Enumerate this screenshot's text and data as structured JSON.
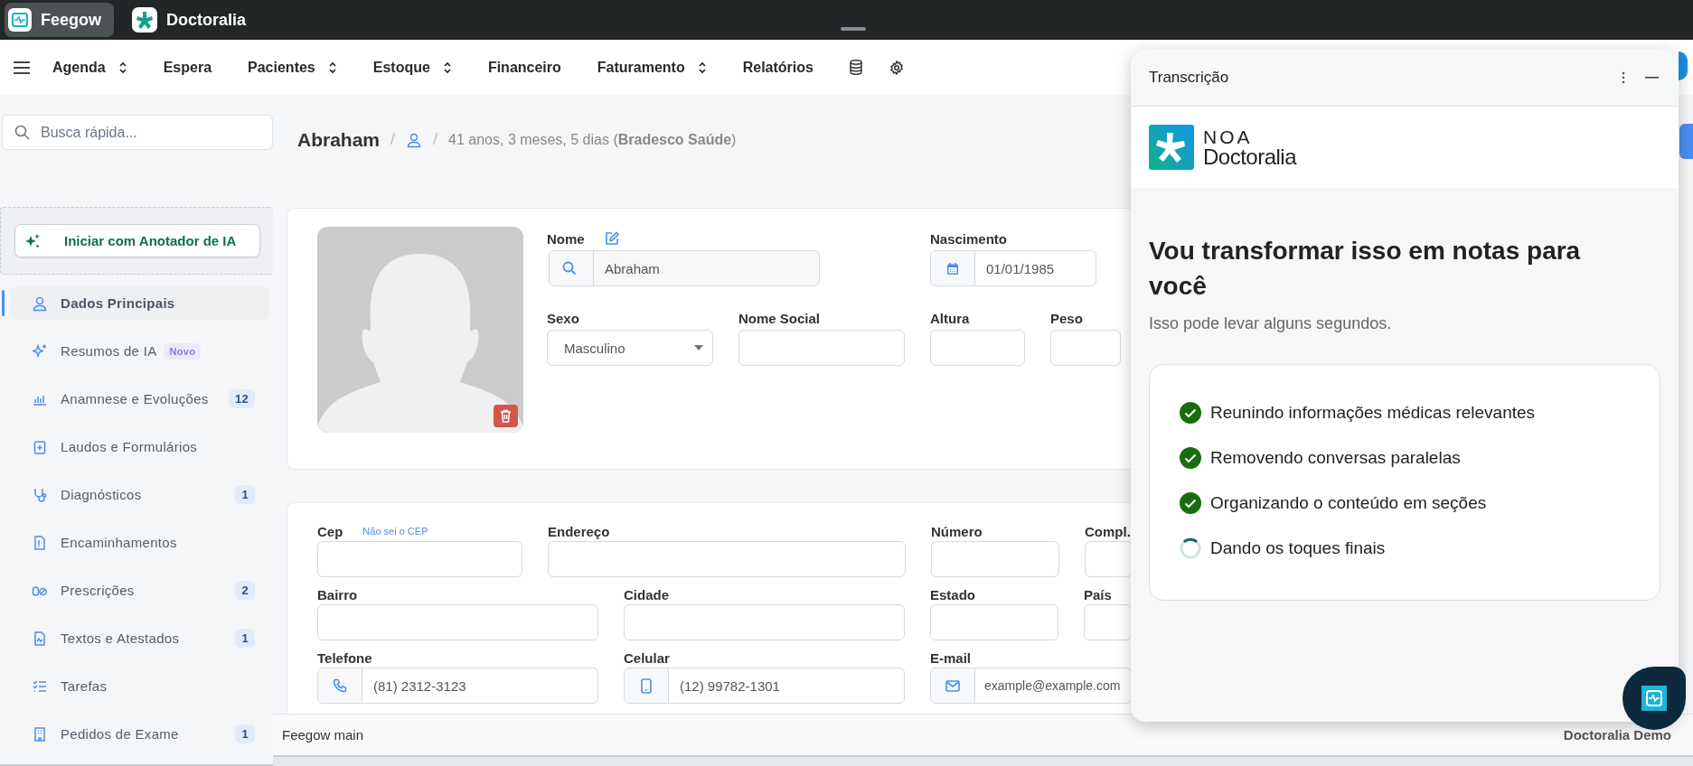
{
  "app_tabs": [
    {
      "label": "Feegow",
      "selected": true
    },
    {
      "label": "Doctoralia",
      "selected": false
    }
  ],
  "nav": [
    {
      "label": "Agenda",
      "dropdown": true
    },
    {
      "label": "Espera",
      "dropdown": false
    },
    {
      "label": "Pacientes",
      "dropdown": true
    },
    {
      "label": "Estoque",
      "dropdown": true
    },
    {
      "label": "Financeiro",
      "dropdown": false
    },
    {
      "label": "Faturamento",
      "dropdown": true
    },
    {
      "label": "Relatórios",
      "dropdown": false
    }
  ],
  "sidebar": {
    "search": {
      "placeholder": "Busca rápida..."
    },
    "ai_button": "Iniciar com Anotador de IA",
    "items": [
      {
        "label": "Dados Principais",
        "selected": true
      },
      {
        "label": "Resumos de IA",
        "selected": false,
        "new_badge": "Novo"
      },
      {
        "label": "Anamnese e Evoluções",
        "selected": false,
        "count": "12"
      },
      {
        "label": "Laudos e Formulários",
        "selected": false
      },
      {
        "label": "Diagnósticos",
        "selected": false,
        "count": "1"
      },
      {
        "label": "Encaminhamentos",
        "selected": false
      },
      {
        "label": "Prescrições",
        "selected": false,
        "count": "2"
      },
      {
        "label": "Textos e Atestados",
        "selected": false,
        "count": "1"
      },
      {
        "label": "Tarefas",
        "selected": false
      },
      {
        "label": "Pedidos de Exame",
        "selected": false,
        "count": "1"
      }
    ]
  },
  "header": {
    "patient": "Abraham",
    "separators": [
      "/",
      "/"
    ],
    "details": "41 anos, 3 meses, 5 dias (**Bradesco Saúde**)"
  },
  "patient_form": {
    "fields": [
      {
        "label": "Nome",
        "kind": "search",
        "value": "Abraham",
        "editable": true
      },
      {
        "label": "Nascimento",
        "kind": "date",
        "value": "01/01/1985"
      },
      {
        "label": "Sexo",
        "kind": "select",
        "value": "Masculino"
      },
      {
        "label": "Nome Social",
        "kind": "text"
      },
      {
        "label": "Altura",
        "kind": "text"
      },
      {
        "label": "Peso",
        "kind": "text"
      }
    ]
  },
  "address_form": {
    "fields": [
      {
        "label": "Cep",
        "kind": "text",
        "link": "Não sei o CEP"
      },
      {
        "label": "Endereço",
        "kind": "text"
      },
      {
        "label": "Número",
        "kind": "text"
      },
      {
        "label": "Compl.",
        "kind": "text"
      },
      {
        "label": "Bairro",
        "kind": "text"
      },
      {
        "label": "Cidade",
        "kind": "text"
      },
      {
        "label": "Estado",
        "kind": "text"
      },
      {
        "label": "País",
        "kind": "text"
      },
      {
        "label": "Telefone",
        "kind": "phone",
        "value": "(81) 2312-3123"
      },
      {
        "label": "Celular",
        "kind": "mobile",
        "value": "(12) 99782-1301"
      },
      {
        "label": "E-mail",
        "kind": "email",
        "value": "example@example.com"
      }
    ]
  },
  "status_bar": {
    "left": "Feegow main",
    "right": "Doctoralia Demo"
  },
  "transcription_panel": {
    "title": "Transcrição",
    "logo_top": "NOA",
    "logo_bottom": "Doctoralia",
    "heading": "Vou transformar isso em notas para você",
    "subtitle": "Isso pode levar alguns segundos.",
    "steps": [
      {
        "label": "Reunindo informações médicas relevantes",
        "done": true
      },
      {
        "label": "Removendo conversas paralelas",
        "done": true
      },
      {
        "label": "Organizando o conteúdo em seções",
        "done": true
      },
      {
        "label": "Dando os toques finais",
        "done": false
      }
    ]
  }
}
